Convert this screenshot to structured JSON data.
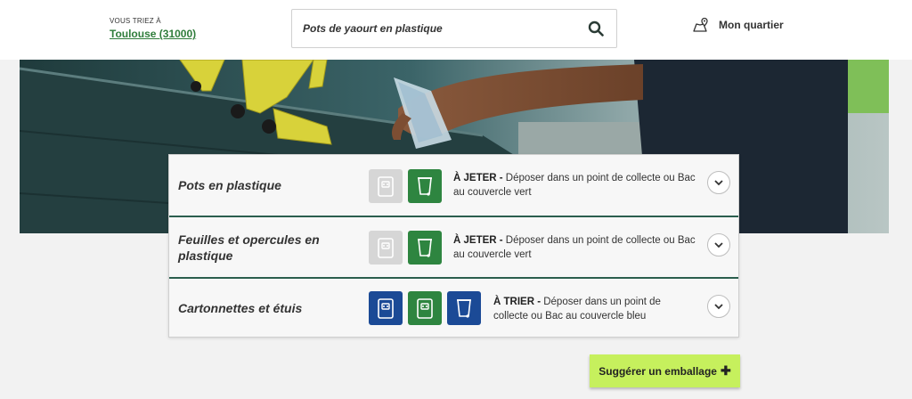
{
  "header": {
    "location_label": "VOUS TRIEZ À",
    "location_city": "Toulouse (31000)",
    "search_value": "Pots de yaourt en plastique",
    "quartier_label": "Mon quartier"
  },
  "results": [
    {
      "name": "Pots en plastique",
      "bins": [
        "grey",
        "green"
      ],
      "action": "À JETER -",
      "instruction": " Déposer dans un point de collecte ou Bac au couvercle vert"
    },
    {
      "name": "Feuilles et opercules en plastique",
      "bins": [
        "grey",
        "green"
      ],
      "action": "À JETER -",
      "instruction": " Déposer dans un point de collecte ou Bac au couvercle vert"
    },
    {
      "name": "Cartonnettes et étuis",
      "bins": [
        "blue",
        "green",
        "blue"
      ],
      "action": "À TRIER -",
      "instruction": " Déposer dans un point de collecte ou Bac au couvercle bleu"
    }
  ],
  "suggest_button": {
    "label": "Suggérer un emballage",
    "icon": "plus-icon"
  },
  "colors": {
    "brand_green": "#2e8540",
    "blue_bin": "#1b4a96",
    "grey_bin": "#d6d6d6",
    "suggest_bg": "#c6f05d",
    "divider": "#2b5e4e"
  }
}
